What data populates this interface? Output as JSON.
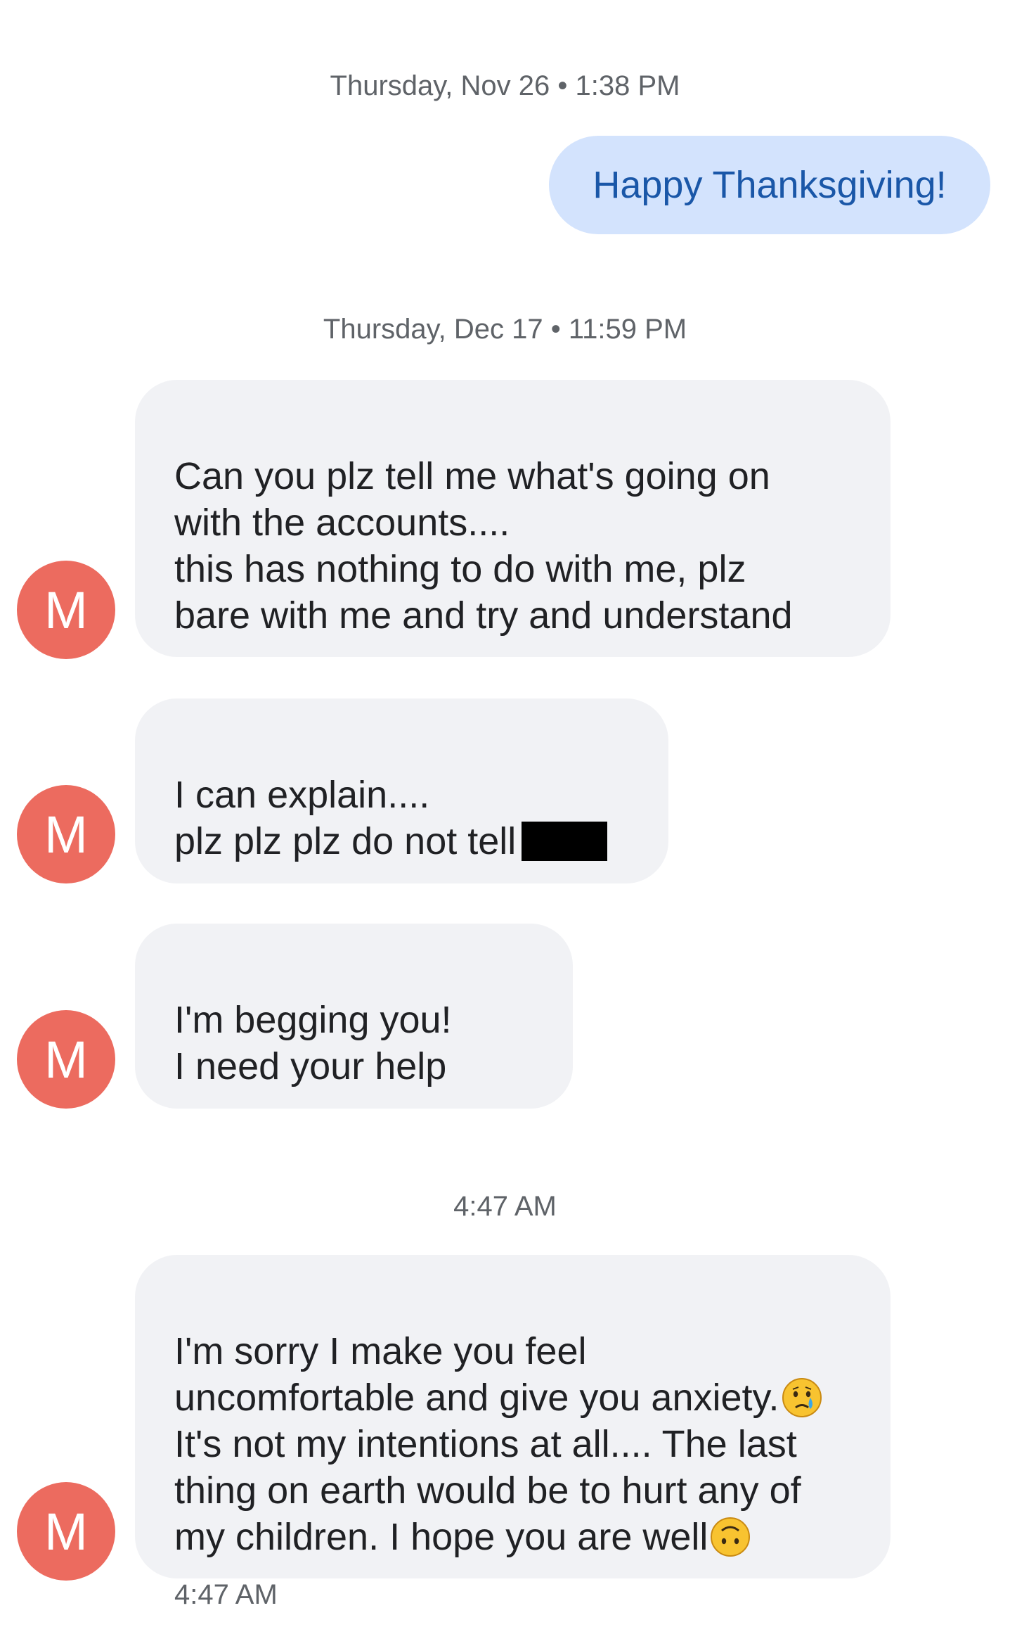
{
  "timestamps": {
    "first": "Thursday, Nov 26 • 1:38 PM",
    "second": "Thursday, Dec 17 • 11:59 PM",
    "third": "4:47 AM"
  },
  "sent": {
    "message": "Happy Thanksgiving!"
  },
  "contact": {
    "initial": "M"
  },
  "received": {
    "m1": "Can you plz tell me what's going on\nwith the accounts....\nthis has nothing to do with me, plz\nbare with me and try and understand",
    "m2_line1": "I can explain....",
    "m2_line2": "plz plz plz do not tell",
    "m3": "I'm begging you!\nI need your help",
    "m4_part1": "I'm sorry I make you feel\nuncomfortable and give you anxiety.",
    "m4_part2": "\nIt's not my intentions at all.... The last\nthing on earth would be to hurt any of\nmy children. I hope you are well"
  },
  "last_message_time": "4:47 AM",
  "icons": {
    "emoji_1": "crying-face-emoji",
    "emoji_2": "upside-down-face-emoji",
    "redaction": "black-redaction-box"
  },
  "colors": {
    "sent_bubble": "#d3e3fd",
    "sent_text": "#1a57a8",
    "received_bubble": "#f1f2f5",
    "avatar": "#ec6b5f",
    "timestamp_text": "#5f6368"
  }
}
